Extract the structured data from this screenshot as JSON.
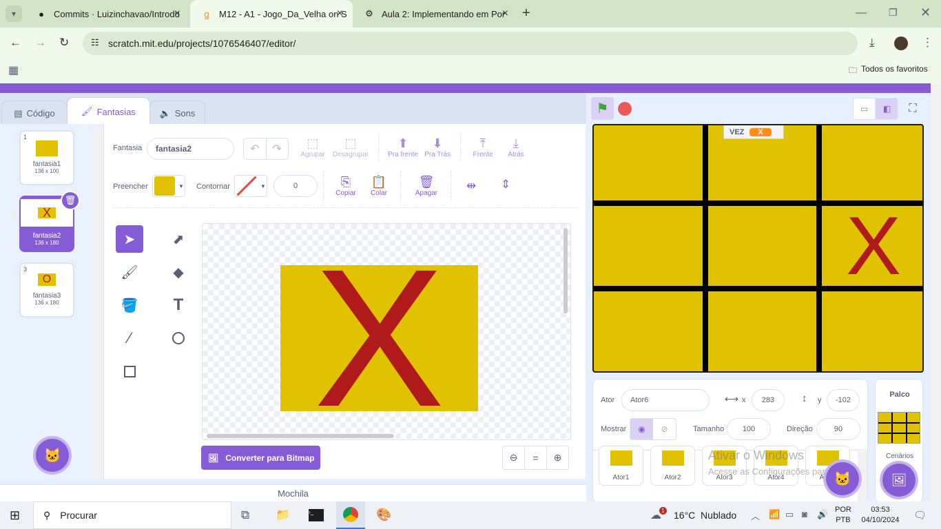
{
  "browser": {
    "tabs": [
      {
        "title": "Commits · Luizinchavao/Introdu",
        "icon": "github-icon"
      },
      {
        "title": "M12 - A1 - Jogo_Da_Velha on S",
        "icon": "scratch-icon"
      },
      {
        "title": "Aula 2: Implementando em Por",
        "icon": "doc-icon"
      }
    ],
    "url": "scratch.mit.edu/projects/1076546407/editor/",
    "bookmarks_label": "Todos os favoritos"
  },
  "editor_tabs": {
    "code": "Código",
    "costumes": "Fantasias",
    "sounds": "Sons"
  },
  "costumes": [
    {
      "num": "1",
      "name": "fantasia1",
      "size": "136 x 100",
      "glyph": ""
    },
    {
      "num": "2",
      "name": "fantasia2",
      "size": "136 x 180",
      "glyph": "X"
    },
    {
      "num": "3",
      "name": "fantasia3",
      "size": "136 x 180",
      "glyph": "O"
    }
  ],
  "paint": {
    "costume_label": "Fantasia",
    "costume_name": "fantasia2",
    "group": "Agrupar",
    "ungroup": "Desagrupar",
    "forward": "Pra frente",
    "backward": "Pra Trás",
    "front": "Frente",
    "back": "Atrás",
    "fill_label": "Preencher",
    "outline_label": "Contornar",
    "outline_width": "0",
    "copy": "Copiar",
    "paste": "Colar",
    "delete": "Apagar",
    "convert": "Converter para Bitmap",
    "zoom_reset": "=",
    "canvas_glyph": "X",
    "fill_color": "#e0c200",
    "glyph_color": "#b01a1a"
  },
  "backpack": "Mochila",
  "stage": {
    "turn_label": "VEZ",
    "turn_value": "X",
    "cells": [
      "",
      "",
      "",
      "",
      "",
      "X",
      "",
      "",
      ""
    ]
  },
  "sprite_info": {
    "sprite_label": "Ator",
    "sprite_name": "Ator6",
    "x_label": "x",
    "x": "283",
    "y_label": "y",
    "y": "-102",
    "show_label": "Mostrar",
    "size_label": "Tamanho",
    "size": "100",
    "direction_label": "Direção",
    "direction": "90"
  },
  "sprites": [
    "Ator1",
    "Ator2",
    "Ator3",
    "Ator4",
    "Ator5"
  ],
  "watermark": {
    "line1": "Ativar o Windows",
    "line2": "Acesse as Configurações para ativar o Windows."
  },
  "stage_panel": {
    "title": "Palco",
    "backdrops": "Cenários"
  },
  "taskbar": {
    "search": "Procurar",
    "weather": "16°C  Nublado",
    "lang1": "POR",
    "lang2": "PTB",
    "time": "03:53",
    "date": "04/10/2024",
    "weather_badge": "1"
  }
}
